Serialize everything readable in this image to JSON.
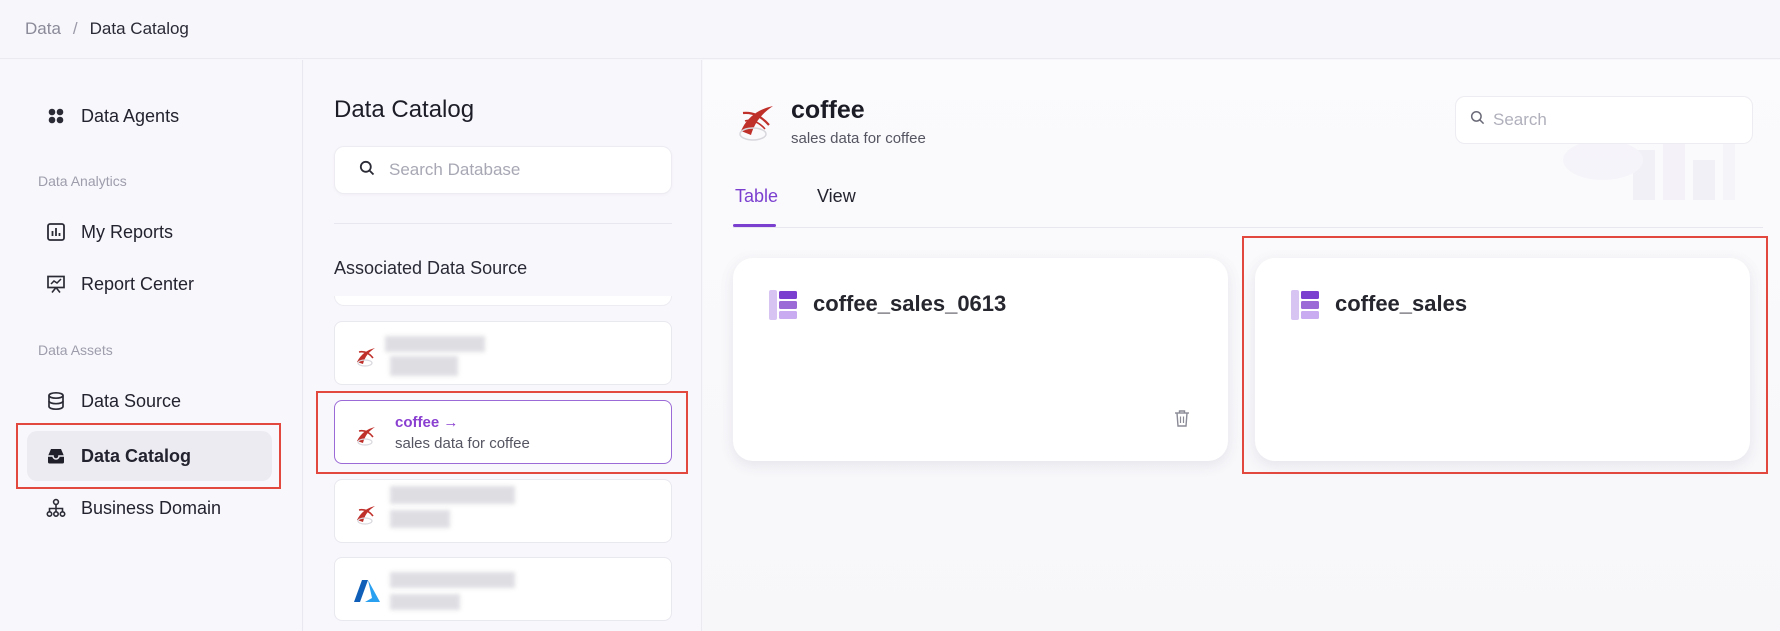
{
  "breadcrumb": {
    "root": "Data",
    "separator": "/",
    "current": "Data Catalog"
  },
  "sidebar": {
    "items": [
      {
        "label": "Data Agents",
        "icon": "agents-icon"
      },
      {
        "label": "My Reports",
        "icon": "reports-icon"
      },
      {
        "label": "Report Center",
        "icon": "report-center-icon"
      },
      {
        "label": "Data Source",
        "icon": "database-icon"
      },
      {
        "label": "Data Catalog",
        "icon": "catalog-icon",
        "active": true
      },
      {
        "label": "Business Domain",
        "icon": "hierarchy-icon"
      }
    ],
    "sections": {
      "analytics": "Data Analytics",
      "assets": "Data Assets"
    }
  },
  "catalog_panel": {
    "title": "Data Catalog",
    "search_placeholder": "Search Database",
    "associated_label": "Associated Data Source",
    "sources": [
      {
        "name": "",
        "description": "",
        "icon": "sql-server-icon",
        "blurred": true
      },
      {
        "name": "coffee →",
        "description": "sales data for coffee",
        "icon": "sql-server-icon",
        "selected": true
      },
      {
        "name": "",
        "description": "",
        "icon": "sql-server-icon",
        "blurred": true
      },
      {
        "name": "",
        "description": "",
        "icon": "azure-icon",
        "blurred": true
      }
    ]
  },
  "main": {
    "db_title": "coffee",
    "db_description": "sales data for coffee",
    "search_placeholder": "Search",
    "tabs": [
      {
        "label": "Table",
        "active": true
      },
      {
        "label": "View"
      }
    ],
    "tables": [
      {
        "name": "coffee_sales_0613"
      },
      {
        "name": "coffee_sales"
      }
    ]
  },
  "colors": {
    "accent": "#7b3fcf",
    "highlight": "#e2483d",
    "sql_server_red": "#c0302b",
    "azure_blue": "#0078d4"
  }
}
